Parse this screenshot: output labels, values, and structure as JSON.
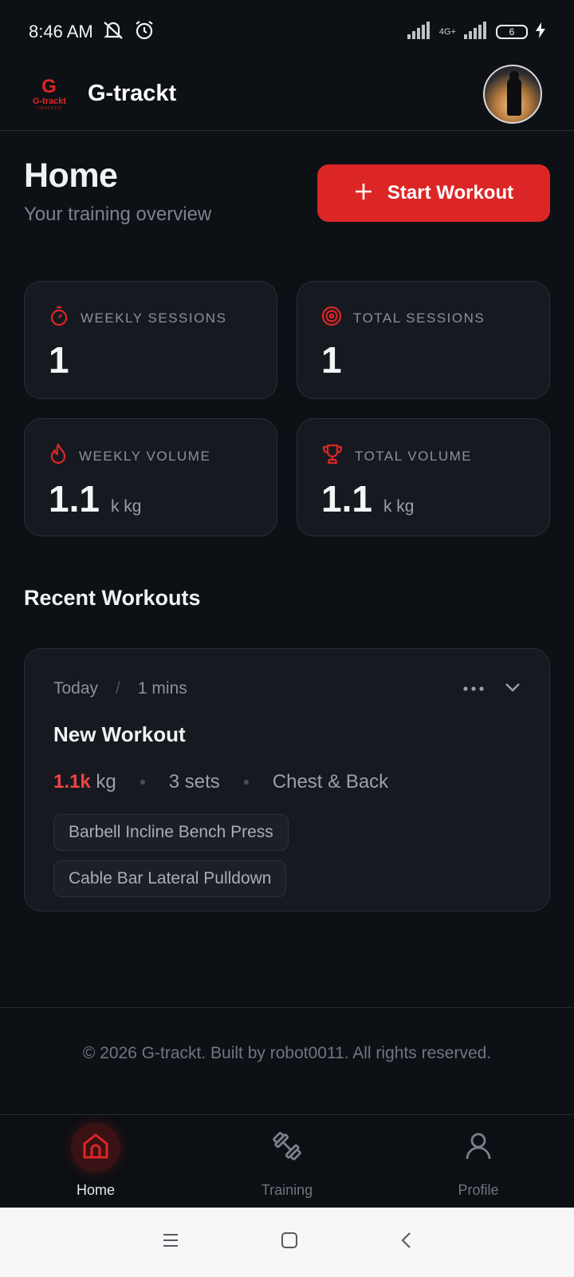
{
  "status_bar": {
    "time": "8:46 AM",
    "network": "4G+",
    "battery": "6"
  },
  "app_bar": {
    "logo_mark": "G",
    "logo_text": "G-trackt",
    "logo_subtext": "TRACKER",
    "title": "G-trackt"
  },
  "header": {
    "title": "Home",
    "subtitle": "Your training overview",
    "start_button": "Start Workout"
  },
  "stats": [
    {
      "icon": "stopwatch-icon",
      "label": "WEEKLY SESSIONS",
      "value": "1",
      "unit": ""
    },
    {
      "icon": "target-icon",
      "label": "TOTAL SESSIONS",
      "value": "1",
      "unit": ""
    },
    {
      "icon": "flame-icon",
      "label": "WEEKLY VOLUME",
      "value": "1.1",
      "unit": "k kg"
    },
    {
      "icon": "trophy-icon",
      "label": "TOTAL VOLUME",
      "value": "1.1",
      "unit": "k kg"
    }
  ],
  "recent": {
    "title": "Recent Workouts",
    "workouts": [
      {
        "day": "Today",
        "separator": "/",
        "duration": "1 mins",
        "name": "New Workout",
        "volume": "1.1k",
        "volume_unit": "kg",
        "sets": "3 sets",
        "muscles": "Chest & Back",
        "exercises": [
          "Barbell Incline Bench Press",
          "Cable Bar Lateral Pulldown"
        ]
      }
    ]
  },
  "footer": {
    "text": "© 2026 G-trackt. Built by robot0011. All rights reserved."
  },
  "bottom_nav": {
    "items": [
      {
        "label": "Home",
        "icon": "home-icon",
        "active": true
      },
      {
        "label": "Training",
        "icon": "dumbbell-icon",
        "active": false
      },
      {
        "label": "Profile",
        "icon": "user-icon",
        "active": false
      }
    ]
  },
  "colors": {
    "accent": "#dc2626",
    "background": "#0d1015",
    "card": "#161a20"
  }
}
